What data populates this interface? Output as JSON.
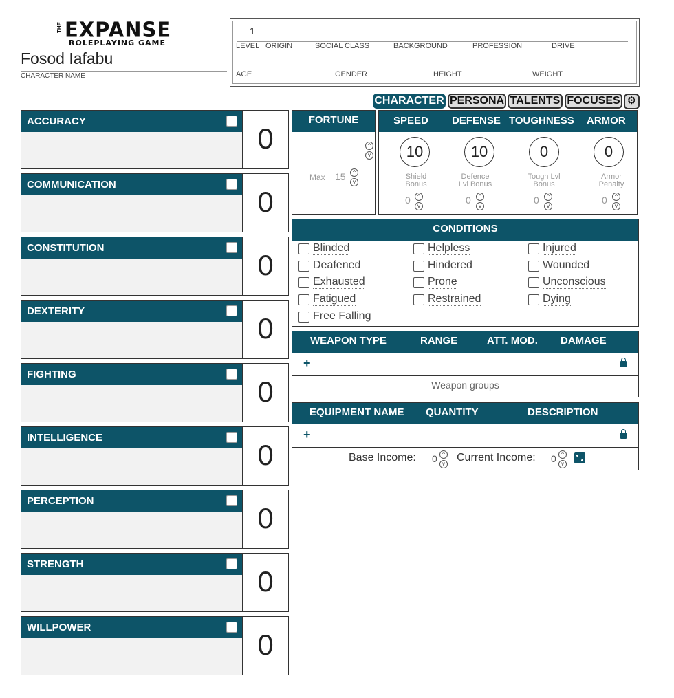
{
  "header": {
    "logo_the": "THE",
    "logo_main": "EXPANSE",
    "logo_sub": "ROLEPLAYING GAME",
    "character_name": "Fosod Iafabu",
    "character_name_label": "CHARACTER NAME"
  },
  "info": {
    "level_value": "1",
    "labels_row1": [
      "LEVEL",
      "ORIGIN",
      "SOCIAL CLASS",
      "BACKGROUND",
      "PROFESSION",
      "DRIVE"
    ],
    "labels_row2": [
      "AGE",
      "GENDER",
      "HEIGHT",
      "WEIGHT"
    ]
  },
  "tabs": [
    {
      "label": "CHARACTER",
      "active": true
    },
    {
      "label": "PERSONA",
      "active": false
    },
    {
      "label": "TALENTS",
      "active": false
    },
    {
      "label": "FOCUSES",
      "active": false
    }
  ],
  "settings_icon": "gear-icon",
  "attributes": [
    {
      "name": "ACCURACY",
      "value": "0"
    },
    {
      "name": "COMMUNICATION",
      "value": "0"
    },
    {
      "name": "CONSTITUTION",
      "value": "0"
    },
    {
      "name": "DEXTERITY",
      "value": "0"
    },
    {
      "name": "FIGHTING",
      "value": "0"
    },
    {
      "name": "INTELLIGENCE",
      "value": "0"
    },
    {
      "name": "PERCEPTION",
      "value": "0"
    },
    {
      "name": "STRENGTH",
      "value": "0"
    },
    {
      "name": "WILLPOWER",
      "value": "0"
    }
  ],
  "fortune": {
    "title": "FORTUNE",
    "max_label": "Max",
    "max_value": "15"
  },
  "stats": {
    "headers": [
      "SPEED",
      "DEFENSE",
      "TOUGHNESS",
      "ARMOR"
    ],
    "values": [
      "10",
      "10",
      "0",
      "0"
    ],
    "sub_labels": [
      [
        "Shield",
        "Bonus"
      ],
      [
        "Defence",
        "Lvl Bonus"
      ],
      [
        "Tough Lvl",
        "Bonus"
      ],
      [
        "Armor",
        "Penalty"
      ]
    ],
    "sub_values": [
      "0",
      "0",
      "0",
      "0"
    ]
  },
  "conditions": {
    "title": "CONDITIONS",
    "col1": [
      "Blinded",
      "Deafened",
      "Exhausted",
      "Fatigued",
      "Free Falling"
    ],
    "col2": [
      "Helpless",
      "Hindered",
      "Prone",
      "Restrained"
    ],
    "col3": [
      "Injured",
      "Wounded",
      "Unconscious",
      "Dying"
    ]
  },
  "weapons": {
    "headers": [
      "WEAPON TYPE",
      "RANGE",
      "ATT. MOD.",
      "DAMAGE"
    ],
    "add_label": "+",
    "groups_label": "Weapon groups"
  },
  "equipment": {
    "headers": [
      "EQUIPMENT NAME",
      "QUANTITY",
      "DESCRIPTION"
    ],
    "add_label": "+",
    "base_income_label": "Base Income:",
    "base_income_value": "0",
    "current_income_label": "Current Income:",
    "current_income_value": "0"
  },
  "colors": {
    "accent": "#0d5468",
    "panel_bg": "#f2f2f2"
  }
}
